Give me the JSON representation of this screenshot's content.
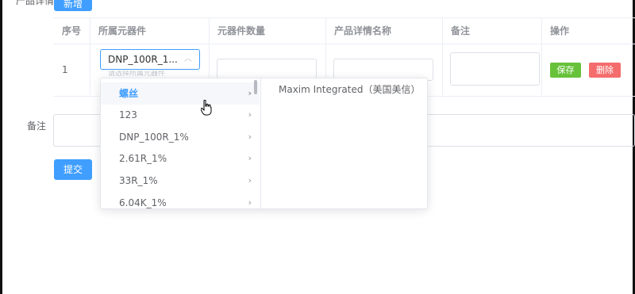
{
  "header": {
    "section_label": "产品详情",
    "add_button": "新增"
  },
  "table": {
    "columns": [
      "序号",
      "所属元器件",
      "元器件数量",
      "产品详情名称",
      "备注",
      "操作"
    ],
    "rows": [
      {
        "index": "1",
        "component_select": "DNP_100R_1...",
        "save_label": "保存",
        "delete_label": "删除"
      }
    ]
  },
  "select_hint": "请选择所属元器件",
  "cascader": {
    "level1": [
      {
        "label": "螺丝",
        "active": true
      },
      {
        "label": "123"
      },
      {
        "label": "DNP_100R_1%"
      },
      {
        "label": "2.61R_1%"
      },
      {
        "label": "33R_1%"
      },
      {
        "label": "6.04K_1%"
      }
    ],
    "level2": [
      {
        "label": "Maxim Integrated（美国美信）"
      }
    ]
  },
  "form": {
    "notes_label": "备注",
    "submit_button": "提交"
  },
  "colors": {
    "primary": "#409eff",
    "success": "#67c23a",
    "danger": "#f56c6c"
  }
}
